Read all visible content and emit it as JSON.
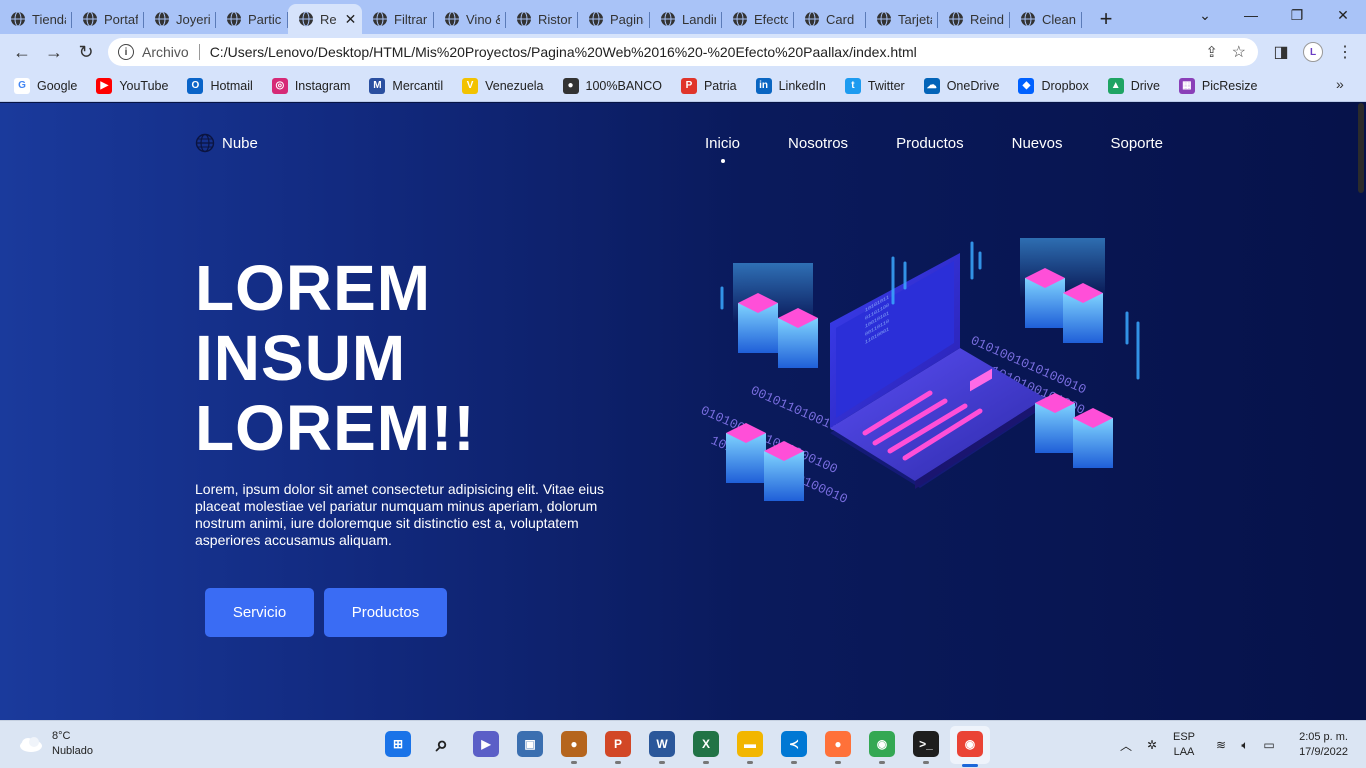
{
  "browser": {
    "tabs": [
      {
        "title": "Tienda"
      },
      {
        "title": "Portafolio"
      },
      {
        "title": "Joyeria"
      },
      {
        "title": "Particles"
      },
      {
        "title": "Re",
        "active": true
      },
      {
        "title": "Filtrar"
      },
      {
        "title": "Vino &"
      },
      {
        "title": "Ristorante"
      },
      {
        "title": "Pagina"
      },
      {
        "title": "Landing"
      },
      {
        "title": "Efecto"
      },
      {
        "title": "Card"
      },
      {
        "title": "Tarjeta"
      },
      {
        "title": "Reindeer"
      },
      {
        "title": "Clean"
      }
    ],
    "scheme_label": "Archivo",
    "url": "C:/Users/Lenovo/Desktop/HTML/Mis%20Proyectos/Pagina%20Web%2016%20-%20Efecto%20Paallax/index.html",
    "bookmarks": [
      {
        "label": "Google",
        "color": "#ffffff",
        "glyph": "G",
        "icon": "google-icon"
      },
      {
        "label": "YouTube",
        "color": "#ff0000",
        "glyph": "▶",
        "icon": "youtube-icon"
      },
      {
        "label": "Hotmail",
        "color": "#0a64c8",
        "glyph": "O",
        "icon": "outlook-icon"
      },
      {
        "label": "Instagram",
        "color": "#d62976",
        "glyph": "◎",
        "icon": "instagram-icon"
      },
      {
        "label": "Mercantil",
        "color": "#2a4fa0",
        "glyph": "M",
        "icon": "mercantil-icon"
      },
      {
        "label": "Venezuela",
        "color": "#f2c200",
        "glyph": "V",
        "icon": "venezuela-icon"
      },
      {
        "label": "100%BANCO",
        "color": "#333333",
        "glyph": "●",
        "icon": "globe-icon"
      },
      {
        "label": "Patria",
        "color": "#e0352b",
        "glyph": "P",
        "icon": "patria-icon"
      },
      {
        "label": "LinkedIn",
        "color": "#0a66c2",
        "glyph": "in",
        "icon": "linkedin-icon"
      },
      {
        "label": "Twitter",
        "color": "#1d9bf0",
        "glyph": "t",
        "icon": "twitter-icon"
      },
      {
        "label": "OneDrive",
        "color": "#0364b8",
        "glyph": "☁",
        "icon": "onedrive-icon"
      },
      {
        "label": "Dropbox",
        "color": "#0061ff",
        "glyph": "◆",
        "icon": "dropbox-icon"
      },
      {
        "label": "Drive",
        "color": "#1fa463",
        "glyph": "▲",
        "icon": "drive-icon"
      },
      {
        "label": "PicResize",
        "color": "#8a3fb8",
        "glyph": "▦",
        "icon": "picresize-icon"
      }
    ]
  },
  "site": {
    "logo": "Nube",
    "menu": [
      "Inicio",
      "Nosotros",
      "Productos",
      "Nuevos",
      "Soporte"
    ],
    "active_menu": "Inicio",
    "hero_lines": [
      "LOREM",
      "INSUM",
      "LOREM!!"
    ],
    "hero_text": "Lorem, ipsum dolor sit amet consectetur adipisicing elit. Vitae eius placeat molestiae vel pariatur numquam minus aperiam, dolorum nostrum animi, iure doloremque sit distinctio est a, voluptatem asperiores accusamus aliquam.",
    "buttons": {
      "servicio": "Servicio",
      "productos": "Productos"
    },
    "accent": "#3a6cf4"
  },
  "taskbar": {
    "weather": {
      "temp": "8°C",
      "condition": "Nublado"
    },
    "apps": [
      {
        "icon": "start-icon",
        "color": "#1a73e8",
        "glyph": "⊞"
      },
      {
        "icon": "search-icon",
        "color": "#dbe5f3",
        "glyph": "⌕"
      },
      {
        "icon": "teams-icon",
        "color": "#5b5fc7",
        "glyph": "▶"
      },
      {
        "icon": "photos-icon",
        "color": "#3b6fb0",
        "glyph": "▣"
      },
      {
        "icon": "baseball-glove-icon",
        "color": "#b5651d",
        "glyph": "●"
      },
      {
        "icon": "powerpoint-icon",
        "color": "#d24726",
        "glyph": "P"
      },
      {
        "icon": "word-icon",
        "color": "#2b579a",
        "glyph": "W"
      },
      {
        "icon": "excel-icon",
        "color": "#217346",
        "glyph": "X"
      },
      {
        "icon": "file-explorer-icon",
        "color": "#f2b600",
        "glyph": "▬"
      },
      {
        "icon": "vscode-icon",
        "color": "#0078d4",
        "glyph": "≺"
      },
      {
        "icon": "firefox-icon",
        "color": "#ff7139",
        "glyph": "●"
      },
      {
        "icon": "chrome-icon",
        "color": "#34a853",
        "glyph": "◉"
      },
      {
        "icon": "terminal-icon",
        "color": "#1e1e1e",
        "glyph": ">_"
      },
      {
        "icon": "chrome-profile-icon",
        "color": "#ea4335",
        "glyph": "◉"
      }
    ],
    "lang_top": "ESP",
    "lang_bottom": "LAA",
    "time": "2:05 p. m.",
    "date": "17/9/2022"
  }
}
